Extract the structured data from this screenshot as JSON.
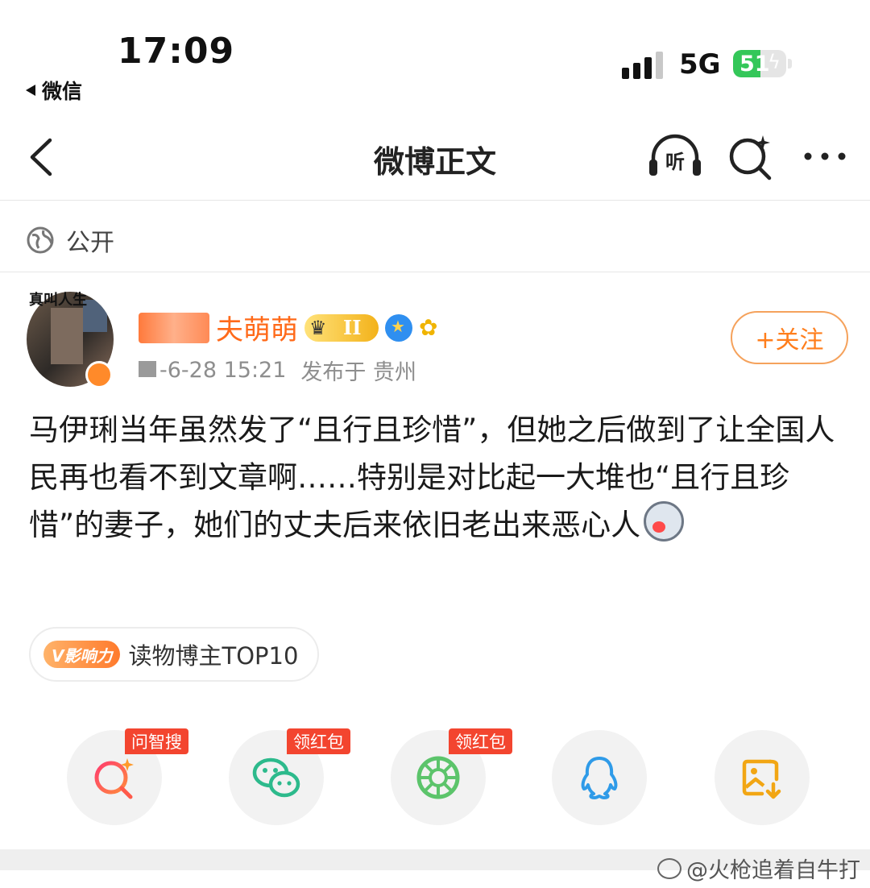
{
  "status_bar": {
    "time": "17:09",
    "back_app": "微信",
    "network": "5G",
    "battery": "51",
    "battery_level": 0.51
  },
  "nav": {
    "title": "微博正文",
    "listen_label": "听"
  },
  "visibility": "公开",
  "author": {
    "avatar_text": "真叫人生",
    "name_suffix": "夫萌萌",
    "level": "II",
    "date": "-6-28 15:21",
    "location": "发布于 贵州",
    "follow_label": "+关注"
  },
  "post": {
    "text": "马伊琍当年虽然发了“且行且珍惜”，但她之后做到了让全国人民再也看不到文章啊……特别是对比起一大堆也“且行且珍惜”的妻子，她们的丈夫后来依旧老出来恶心人"
  },
  "tag": {
    "badge": "V影响力",
    "label": "读物博主TOP10"
  },
  "share": [
    {
      "name": "search",
      "ribbon": "问智搜"
    },
    {
      "name": "wechat",
      "ribbon": "领红包"
    },
    {
      "name": "moments",
      "ribbon": "领红包"
    },
    {
      "name": "qq",
      "ribbon": ""
    },
    {
      "name": "save-image",
      "ribbon": ""
    }
  ],
  "watermark": "@火枪追着自牛打",
  "colors": {
    "accent": "#ff7e1c",
    "ribbon": "#f3452f",
    "battery": "#34c759"
  }
}
